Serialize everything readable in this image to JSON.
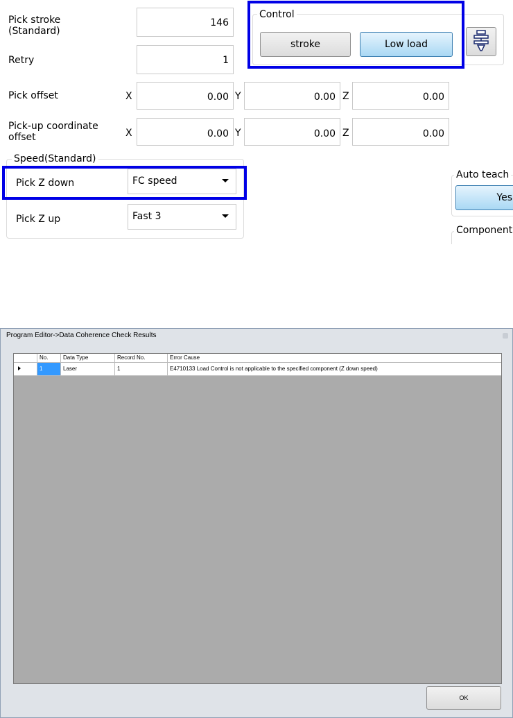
{
  "top_panel": {
    "pick_stroke_label": "Pick stroke\n(Standard)",
    "pick_stroke_value": "146",
    "retry_label": "Retry",
    "retry_value": "1",
    "control": {
      "title": "Control",
      "stroke_button": "stroke",
      "low_load_button": "Low load"
    },
    "pick_offset": {
      "label": "Pick offset",
      "x_label": "X",
      "x": "0.00",
      "y_label": "Y",
      "y": "0.00",
      "z_label": "Z",
      "z": "0.00"
    },
    "pickup_coord_offset": {
      "label": "Pick-up coordinate\noffset",
      "x_label": "X",
      "x": "0.00",
      "y_label": "Y",
      "y": "0.00",
      "z_label": "Z",
      "z": "0.00"
    },
    "speed": {
      "title": "Speed(Standard)",
      "pick_z_down_label": "Pick Z down",
      "pick_z_down_value": "FC speed",
      "pick_z_up_label": "Pick Z up",
      "pick_z_up_value": "Fast 3"
    },
    "auto_teach": {
      "title": "Auto teach",
      "yes_button": "Yes"
    },
    "component_title": "Component",
    "icon": "nozzle-icon"
  },
  "dialog": {
    "title": "Program Editor->Data Coherence Check Results",
    "columns": [
      "No.",
      "Data Type",
      "Record No.",
      "Error Cause"
    ],
    "rows": [
      {
        "no": "1",
        "data_type": "Laser",
        "record_no": "1",
        "error_cause": "E4710133 Load Control is not applicable to the specified component (Z down speed)"
      }
    ],
    "ok_button": "OK"
  },
  "colors": {
    "highlight": "#0000e6",
    "grid_background": "#ababab",
    "selected_cell": "#3399ff"
  }
}
